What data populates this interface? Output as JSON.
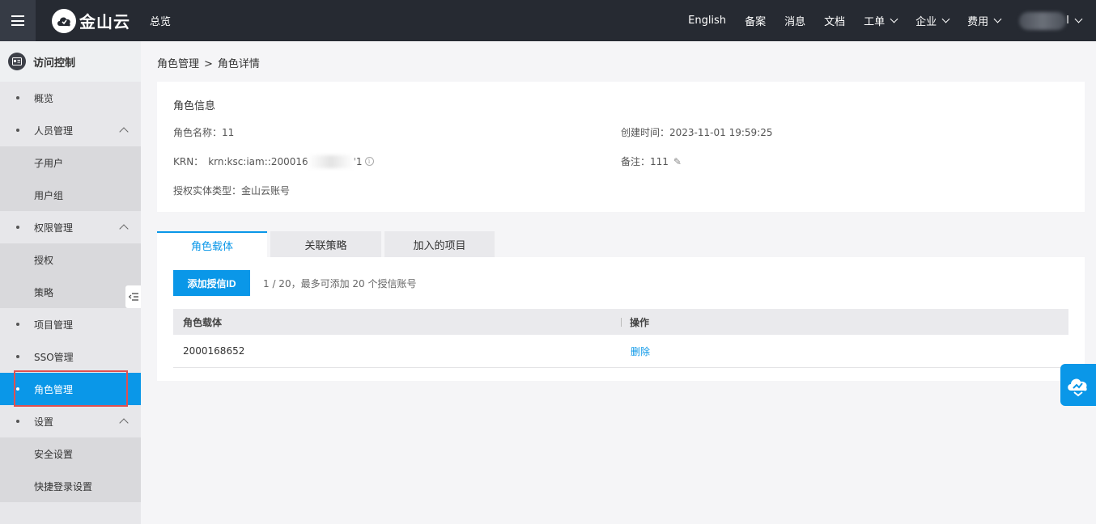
{
  "header": {
    "logo_text": "金山云",
    "overview": "总览",
    "nav": [
      {
        "label": "English",
        "dropdown": false
      },
      {
        "label": "备案",
        "dropdown": false
      },
      {
        "label": "消息",
        "dropdown": false
      },
      {
        "label": "文档",
        "dropdown": false
      },
      {
        "label": "工单",
        "dropdown": true
      },
      {
        "label": "企业",
        "dropdown": true
      },
      {
        "label": "费用",
        "dropdown": true
      }
    ],
    "user_suffix": "I"
  },
  "sidebar": {
    "title": "访问控制",
    "overview": "概览",
    "people": "人员管理",
    "sub_user": "子用户",
    "user_group": "用户组",
    "permission": "权限管理",
    "authorize": "授权",
    "policy": "策略",
    "project": "项目管理",
    "sso": "SSO管理",
    "role": "角色管理",
    "settings": "设置",
    "security": "安全设置",
    "quick_login": "快捷登录设置"
  },
  "breadcrumb": {
    "parent": "角色管理",
    "separator": ">",
    "current": "角色详情"
  },
  "role_info": {
    "title": "角色信息",
    "name_label": "角色名称：",
    "name_value": "11",
    "krn_label": "KRN：",
    "krn_prefix": "krn:ksc:iam::200016",
    "krn_suffix": "'1",
    "entity_label": "授权实体类型：",
    "entity_value": "金山云账号",
    "created_label": "创建时间：",
    "created_value": "2023-11-01 19:59:25",
    "remark_label": "备注：",
    "remark_value": "111"
  },
  "tabs": [
    "角色载体",
    "关联策略",
    "加入的项目"
  ],
  "carrier": {
    "add_button": "添加授信ID",
    "count_text": "1 / 20，最多可添加 20 个授信账号",
    "columns": [
      "角色载体",
      "操作"
    ],
    "rows": [
      {
        "id": "2000168652",
        "action": "删除"
      }
    ]
  },
  "colors": {
    "accent": "#0a97e8",
    "topbar": "#262a32",
    "highlight_outline": "#e05050"
  }
}
